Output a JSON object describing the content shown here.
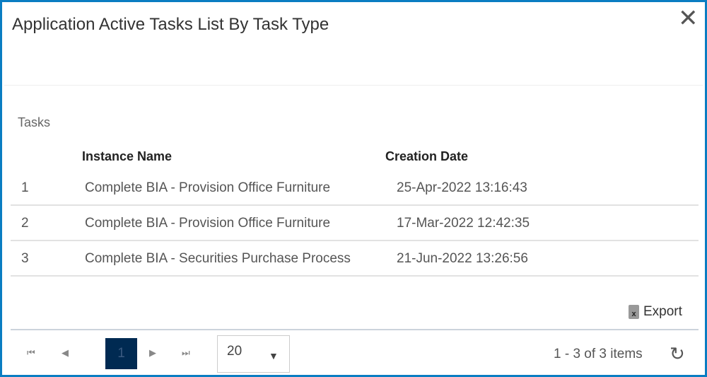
{
  "dialog": {
    "title": "Application Active Tasks List By Task Type",
    "close_icon": "✕"
  },
  "section_label": "Tasks",
  "table": {
    "headers": [
      "Instance Name",
      "Creation Date"
    ],
    "rows": [
      {
        "num": "1",
        "name": "Complete BIA - Provision Office Furniture",
        "date": "25-Apr-2022 13:16:43"
      },
      {
        "num": "2",
        "name": "Complete BIA - Provision Office Furniture",
        "date": "17-Mar-2022 12:42:35"
      },
      {
        "num": "3",
        "name": "Complete BIA - Securities Purchase Process",
        "date": "21-Jun-2022 13:26:56"
      }
    ]
  },
  "export": {
    "label": "Export",
    "icon": "x"
  },
  "pager": {
    "first": "⏮",
    "prev": "◀",
    "page": "1",
    "next": "▶",
    "last": "⏭",
    "page_size": "20",
    "caret": "▼",
    "info": "1 - 3 of 3 items",
    "refresh": "↻"
  }
}
